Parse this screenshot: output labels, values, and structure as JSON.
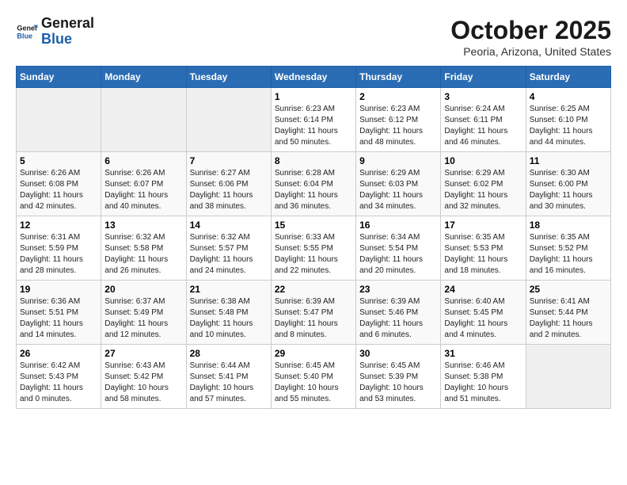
{
  "header": {
    "logo_line1": "General",
    "logo_line2": "Blue",
    "month": "October 2025",
    "location": "Peoria, Arizona, United States"
  },
  "weekdays": [
    "Sunday",
    "Monday",
    "Tuesday",
    "Wednesday",
    "Thursday",
    "Friday",
    "Saturday"
  ],
  "weeks": [
    [
      {
        "day": "",
        "info": ""
      },
      {
        "day": "",
        "info": ""
      },
      {
        "day": "",
        "info": ""
      },
      {
        "day": "1",
        "info": "Sunrise: 6:23 AM\nSunset: 6:14 PM\nDaylight: 11 hours\nand 50 minutes."
      },
      {
        "day": "2",
        "info": "Sunrise: 6:23 AM\nSunset: 6:12 PM\nDaylight: 11 hours\nand 48 minutes."
      },
      {
        "day": "3",
        "info": "Sunrise: 6:24 AM\nSunset: 6:11 PM\nDaylight: 11 hours\nand 46 minutes."
      },
      {
        "day": "4",
        "info": "Sunrise: 6:25 AM\nSunset: 6:10 PM\nDaylight: 11 hours\nand 44 minutes."
      }
    ],
    [
      {
        "day": "5",
        "info": "Sunrise: 6:26 AM\nSunset: 6:08 PM\nDaylight: 11 hours\nand 42 minutes."
      },
      {
        "day": "6",
        "info": "Sunrise: 6:26 AM\nSunset: 6:07 PM\nDaylight: 11 hours\nand 40 minutes."
      },
      {
        "day": "7",
        "info": "Sunrise: 6:27 AM\nSunset: 6:06 PM\nDaylight: 11 hours\nand 38 minutes."
      },
      {
        "day": "8",
        "info": "Sunrise: 6:28 AM\nSunset: 6:04 PM\nDaylight: 11 hours\nand 36 minutes."
      },
      {
        "day": "9",
        "info": "Sunrise: 6:29 AM\nSunset: 6:03 PM\nDaylight: 11 hours\nand 34 minutes."
      },
      {
        "day": "10",
        "info": "Sunrise: 6:29 AM\nSunset: 6:02 PM\nDaylight: 11 hours\nand 32 minutes."
      },
      {
        "day": "11",
        "info": "Sunrise: 6:30 AM\nSunset: 6:00 PM\nDaylight: 11 hours\nand 30 minutes."
      }
    ],
    [
      {
        "day": "12",
        "info": "Sunrise: 6:31 AM\nSunset: 5:59 PM\nDaylight: 11 hours\nand 28 minutes."
      },
      {
        "day": "13",
        "info": "Sunrise: 6:32 AM\nSunset: 5:58 PM\nDaylight: 11 hours\nand 26 minutes."
      },
      {
        "day": "14",
        "info": "Sunrise: 6:32 AM\nSunset: 5:57 PM\nDaylight: 11 hours\nand 24 minutes."
      },
      {
        "day": "15",
        "info": "Sunrise: 6:33 AM\nSunset: 5:55 PM\nDaylight: 11 hours\nand 22 minutes."
      },
      {
        "day": "16",
        "info": "Sunrise: 6:34 AM\nSunset: 5:54 PM\nDaylight: 11 hours\nand 20 minutes."
      },
      {
        "day": "17",
        "info": "Sunrise: 6:35 AM\nSunset: 5:53 PM\nDaylight: 11 hours\nand 18 minutes."
      },
      {
        "day": "18",
        "info": "Sunrise: 6:35 AM\nSunset: 5:52 PM\nDaylight: 11 hours\nand 16 minutes."
      }
    ],
    [
      {
        "day": "19",
        "info": "Sunrise: 6:36 AM\nSunset: 5:51 PM\nDaylight: 11 hours\nand 14 minutes."
      },
      {
        "day": "20",
        "info": "Sunrise: 6:37 AM\nSunset: 5:49 PM\nDaylight: 11 hours\nand 12 minutes."
      },
      {
        "day": "21",
        "info": "Sunrise: 6:38 AM\nSunset: 5:48 PM\nDaylight: 11 hours\nand 10 minutes."
      },
      {
        "day": "22",
        "info": "Sunrise: 6:39 AM\nSunset: 5:47 PM\nDaylight: 11 hours\nand 8 minutes."
      },
      {
        "day": "23",
        "info": "Sunrise: 6:39 AM\nSunset: 5:46 PM\nDaylight: 11 hours\nand 6 minutes."
      },
      {
        "day": "24",
        "info": "Sunrise: 6:40 AM\nSunset: 5:45 PM\nDaylight: 11 hours\nand 4 minutes."
      },
      {
        "day": "25",
        "info": "Sunrise: 6:41 AM\nSunset: 5:44 PM\nDaylight: 11 hours\nand 2 minutes."
      }
    ],
    [
      {
        "day": "26",
        "info": "Sunrise: 6:42 AM\nSunset: 5:43 PM\nDaylight: 11 hours\nand 0 minutes."
      },
      {
        "day": "27",
        "info": "Sunrise: 6:43 AM\nSunset: 5:42 PM\nDaylight: 10 hours\nand 58 minutes."
      },
      {
        "day": "28",
        "info": "Sunrise: 6:44 AM\nSunset: 5:41 PM\nDaylight: 10 hours\nand 57 minutes."
      },
      {
        "day": "29",
        "info": "Sunrise: 6:45 AM\nSunset: 5:40 PM\nDaylight: 10 hours\nand 55 minutes."
      },
      {
        "day": "30",
        "info": "Sunrise: 6:45 AM\nSunset: 5:39 PM\nDaylight: 10 hours\nand 53 minutes."
      },
      {
        "day": "31",
        "info": "Sunrise: 6:46 AM\nSunset: 5:38 PM\nDaylight: 10 hours\nand 51 minutes."
      },
      {
        "day": "",
        "info": ""
      }
    ]
  ]
}
